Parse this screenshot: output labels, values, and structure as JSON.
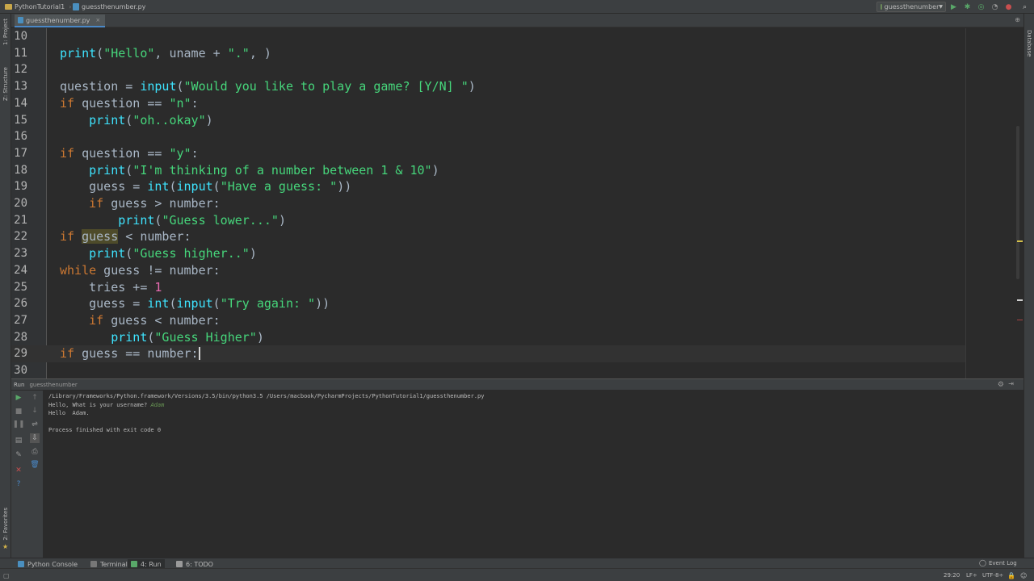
{
  "navbar": {
    "project": "PythonTutorial1",
    "file": "guessthenumber.py",
    "run_config": "guessthenumber",
    "buttons": [
      {
        "name": "run-button",
        "glyph": "▶",
        "color": "#59a869"
      },
      {
        "name": "debug-button",
        "glyph": "✱",
        "color": "#59a869"
      },
      {
        "name": "coverage-button",
        "glyph": "◎",
        "color": "#59a869"
      },
      {
        "name": "profile-button",
        "glyph": "◔",
        "color": "#9a9a9a"
      },
      {
        "name": "stop-button",
        "glyph": "●",
        "color": "#c94f4f"
      },
      {
        "name": "search-everywhere-button",
        "glyph": "⌕",
        "color": "#bbbbbb"
      }
    ]
  },
  "left_strip": {
    "project_tab": "1: Project",
    "structure_tab": "Z: Structure",
    "favorites_tab": "2: Favorites"
  },
  "right_strip": {
    "database_tab": "Database"
  },
  "editor": {
    "tab_label": "guessthenumber.py",
    "tab_close": "×",
    "lines": [
      {
        "n": "10",
        "tokens": []
      },
      {
        "n": "11",
        "tokens": [
          {
            "t": "print",
            "c": "fn"
          },
          {
            "t": "(",
            "c": ""
          },
          {
            "t": "\"Hello\"",
            "c": "str"
          },
          {
            "t": ", uname + ",
            "c": ""
          },
          {
            "t": "\".\"",
            "c": "str"
          },
          {
            "t": ", )",
            "c": ""
          }
        ]
      },
      {
        "n": "12",
        "tokens": []
      },
      {
        "n": "13",
        "tokens": [
          {
            "t": "question = ",
            "c": ""
          },
          {
            "t": "input",
            "c": "fn"
          },
          {
            "t": "(",
            "c": ""
          },
          {
            "t": "\"Would you like to play a game? [Y/N] \"",
            "c": "str"
          },
          {
            "t": ")",
            "c": ""
          }
        ]
      },
      {
        "n": "14",
        "tokens": [
          {
            "t": "if",
            "c": "kw"
          },
          {
            "t": " question == ",
            "c": ""
          },
          {
            "t": "\"n\"",
            "c": "str"
          },
          {
            "t": ":",
            "c": ""
          }
        ]
      },
      {
        "n": "15",
        "tokens": [
          {
            "t": "    ",
            "c": ""
          },
          {
            "t": "print",
            "c": "fn"
          },
          {
            "t": "(",
            "c": ""
          },
          {
            "t": "\"oh..okay\"",
            "c": "str"
          },
          {
            "t": ")",
            "c": ""
          }
        ]
      },
      {
        "n": "16",
        "tokens": []
      },
      {
        "n": "17",
        "tokens": [
          {
            "t": "if",
            "c": "kw"
          },
          {
            "t": " question == ",
            "c": ""
          },
          {
            "t": "\"y\"",
            "c": "str"
          },
          {
            "t": ":",
            "c": ""
          }
        ]
      },
      {
        "n": "18",
        "tokens": [
          {
            "t": "    ",
            "c": ""
          },
          {
            "t": "print",
            "c": "fn"
          },
          {
            "t": "(",
            "c": ""
          },
          {
            "t": "\"I'm thinking of a number between 1 & 10\"",
            "c": "str"
          },
          {
            "t": ")",
            "c": ""
          }
        ]
      },
      {
        "n": "19",
        "tokens": [
          {
            "t": "    guess = ",
            "c": ""
          },
          {
            "t": "int",
            "c": "fn"
          },
          {
            "t": "(",
            "c": ""
          },
          {
            "t": "input",
            "c": "fn"
          },
          {
            "t": "(",
            "c": ""
          },
          {
            "t": "\"Have a guess: \"",
            "c": "str"
          },
          {
            "t": "))",
            "c": ""
          }
        ]
      },
      {
        "n": "20",
        "tokens": [
          {
            "t": "    ",
            "c": ""
          },
          {
            "t": "if",
            "c": "kw"
          },
          {
            "t": " guess > number:",
            "c": ""
          }
        ]
      },
      {
        "n": "21",
        "tokens": [
          {
            "t": "        ",
            "c": ""
          },
          {
            "t": "print",
            "c": "fn"
          },
          {
            "t": "(",
            "c": ""
          },
          {
            "t": "\"Guess lower...\"",
            "c": "str"
          },
          {
            "t": ")",
            "c": ""
          }
        ]
      },
      {
        "n": "22",
        "tokens": [
          {
            "t": "if",
            "c": "kw"
          },
          {
            "t": " ",
            "c": ""
          },
          {
            "t": "guess",
            "c": "hl"
          },
          {
            "t": " < number:",
            "c": ""
          }
        ]
      },
      {
        "n": "23",
        "tokens": [
          {
            "t": "    ",
            "c": ""
          },
          {
            "t": "print",
            "c": "fn"
          },
          {
            "t": "(",
            "c": ""
          },
          {
            "t": "\"Guess higher..\"",
            "c": "str"
          },
          {
            "t": ")",
            "c": ""
          }
        ]
      },
      {
        "n": "24",
        "tokens": [
          {
            "t": "while",
            "c": "kw"
          },
          {
            "t": " guess != number:",
            "c": ""
          }
        ]
      },
      {
        "n": "25",
        "tokens": [
          {
            "t": "    tries += ",
            "c": ""
          },
          {
            "t": "1",
            "c": "num"
          }
        ]
      },
      {
        "n": "26",
        "tokens": [
          {
            "t": "    guess = ",
            "c": ""
          },
          {
            "t": "int",
            "c": "fn"
          },
          {
            "t": "(",
            "c": ""
          },
          {
            "t": "input",
            "c": "fn"
          },
          {
            "t": "(",
            "c": ""
          },
          {
            "t": "\"Try again: \"",
            "c": "str"
          },
          {
            "t": "))",
            "c": ""
          }
        ]
      },
      {
        "n": "27",
        "tokens": [
          {
            "t": "    ",
            "c": ""
          },
          {
            "t": "if",
            "c": "kw"
          },
          {
            "t": " guess < number:",
            "c": ""
          }
        ]
      },
      {
        "n": "28",
        "tokens": [
          {
            "t": "       ",
            "c": ""
          },
          {
            "t": "print",
            "c": "fn"
          },
          {
            "t": "(",
            "c": ""
          },
          {
            "t": "\"Guess Higher\"",
            "c": "str"
          },
          {
            "t": ")",
            "c": ""
          }
        ]
      },
      {
        "n": "29",
        "tokens": [
          {
            "t": "if",
            "c": "kw"
          },
          {
            "t": " guess == number:",
            "c": ""
          }
        ],
        "current": true
      },
      {
        "n": "30",
        "tokens": []
      }
    ]
  },
  "run_panel": {
    "title": "Run",
    "config": "guessthenumber",
    "console": [
      {
        "text": "/Library/Frameworks/Python.framework/Versions/3.5/bin/python3.5 /Users/macbook/PycharmProjects/PythonTutorial1/guessthenumber.py",
        "input": ""
      },
      {
        "text": "Hello, What is your username? ",
        "input": "Adam"
      },
      {
        "text": "Hello  Adam.",
        "input": ""
      },
      {
        "text": "",
        "input": ""
      },
      {
        "text": "Process finished with exit code 0",
        "input": ""
      }
    ]
  },
  "bottom_tabs": [
    {
      "label": "Python Console",
      "color": "#4a8fbf",
      "active": false
    },
    {
      "label": "Terminal",
      "color": "#777777",
      "active": false
    },
    {
      "label": "4: Run",
      "color": "#59a869",
      "active": true
    },
    {
      "label": "6: TODO",
      "color": "#9a9a9a",
      "active": false
    }
  ],
  "status": {
    "event_log": "Event Log",
    "position": "29:20",
    "line_sep": "LF÷",
    "encoding": "UTF-8÷"
  }
}
